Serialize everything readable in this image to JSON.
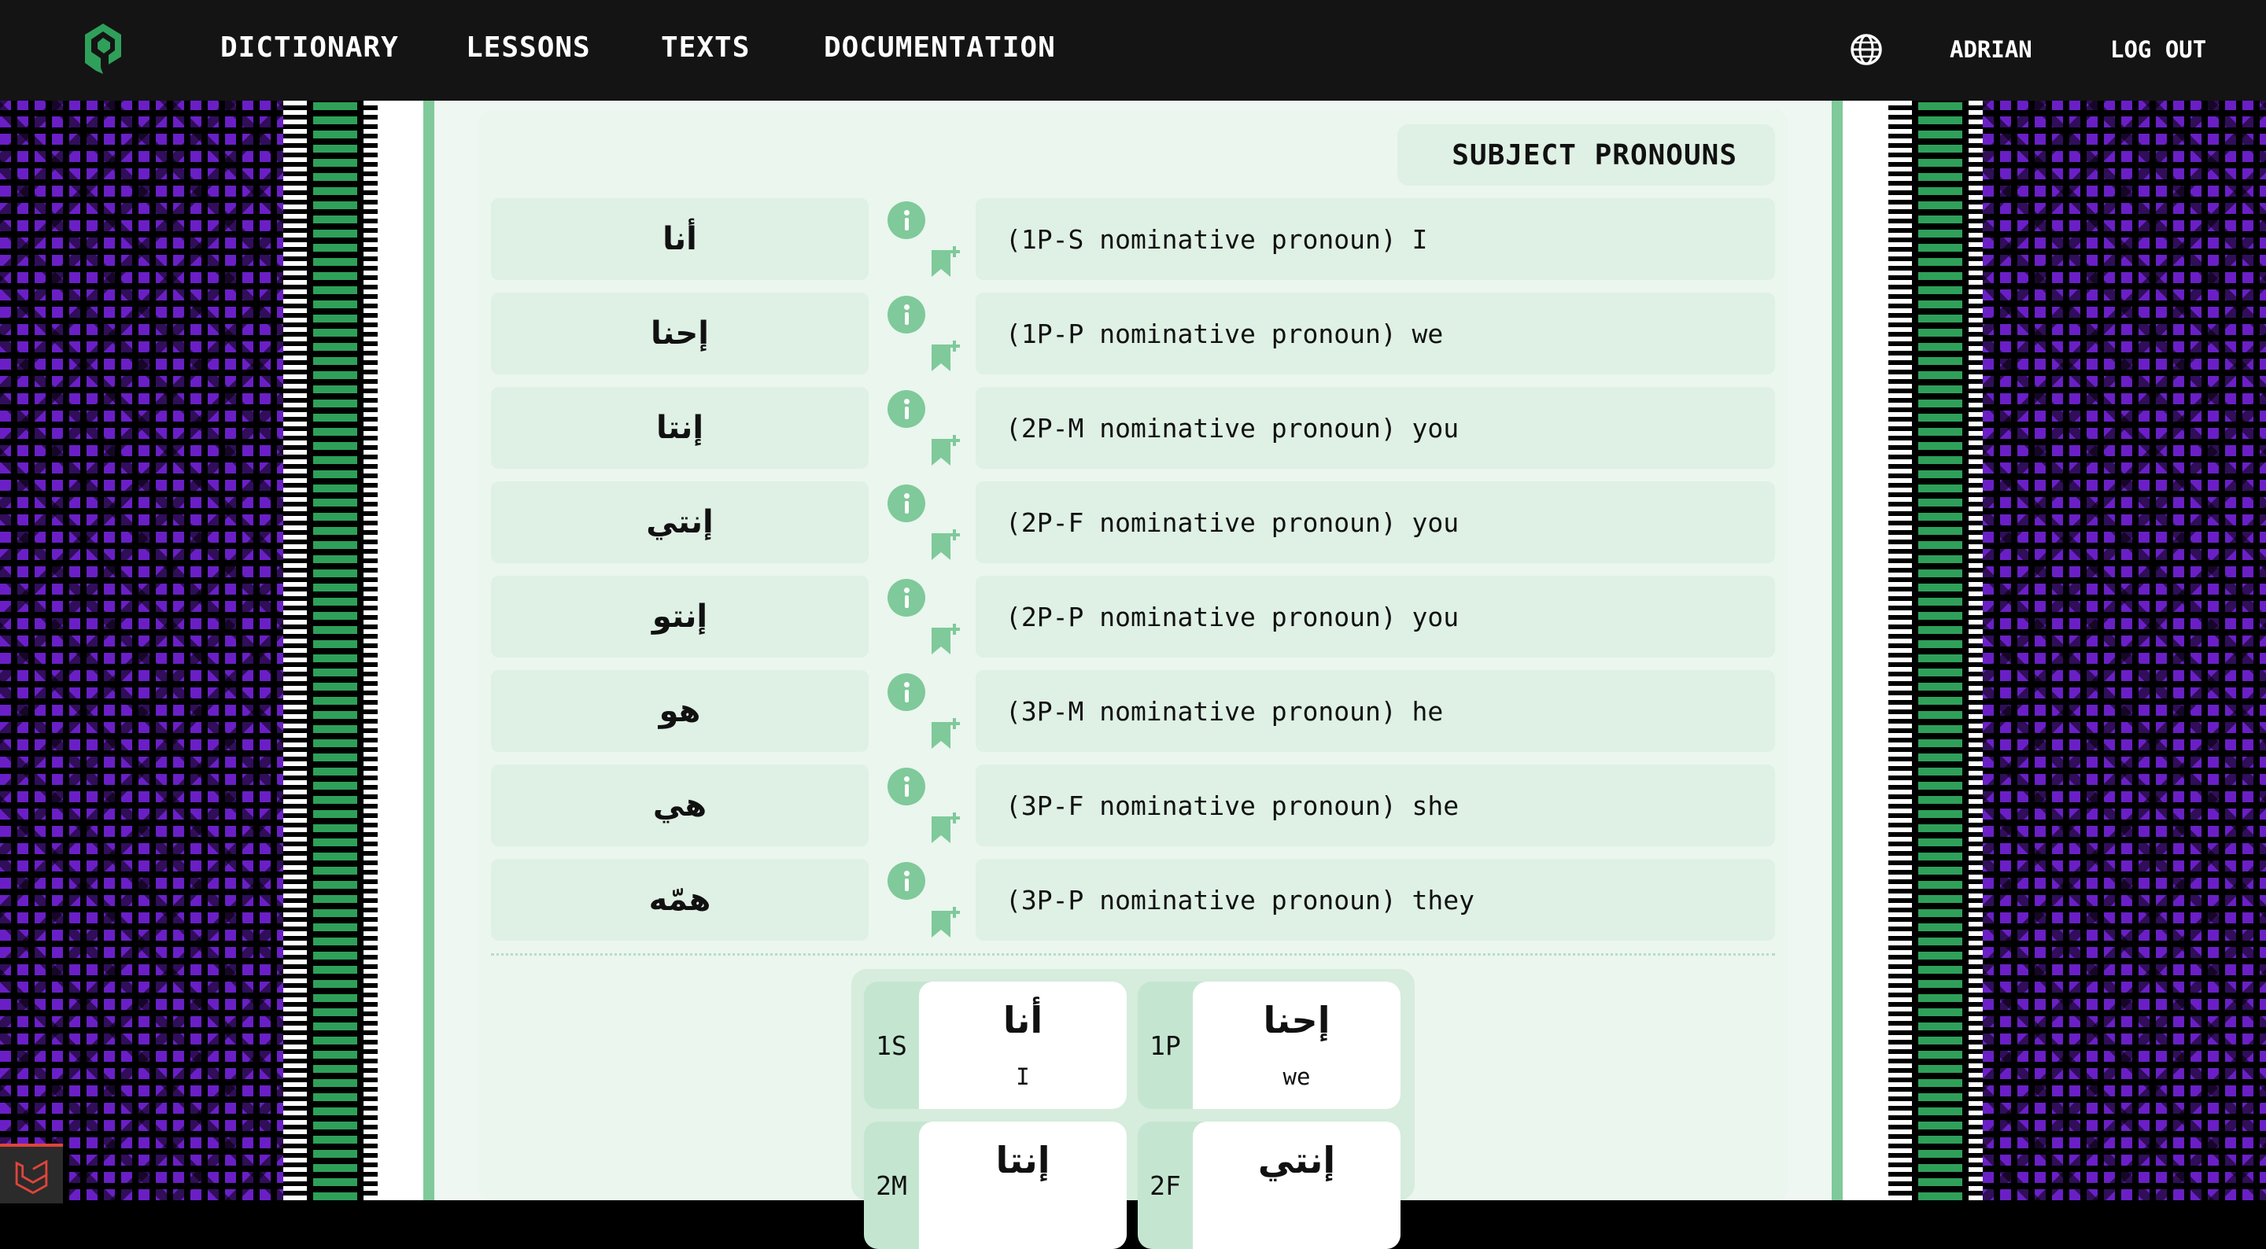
{
  "nav": {
    "logo_alt": "",
    "links": [
      "DICTIONARY",
      "LESSONS",
      "TEXTS",
      "DOCUMENTATION"
    ],
    "user": "ADRIAN",
    "logout": "LOG OUT",
    "language_icon": "globe-icon"
  },
  "section": {
    "title": "SUBJECT PRONOUNS"
  },
  "rows": [
    {
      "arabic": "أنا",
      "definition": "(1P-S nominative pronoun) I"
    },
    {
      "arabic": "إحنا",
      "definition": "(1P-P nominative pronoun) we"
    },
    {
      "arabic": "إنتا",
      "definition": "(2P-M nominative pronoun) you"
    },
    {
      "arabic": "إنتي",
      "definition": "(2P-F nominative pronoun) you"
    },
    {
      "arabic": "إنتو",
      "definition": "(2P-P nominative pronoun) you"
    },
    {
      "arabic": "هو",
      "definition": "(3P-M nominative pronoun) he"
    },
    {
      "arabic": "هي",
      "definition": "(3P-F nominative pronoun) she"
    },
    {
      "arabic": "همّه",
      "definition": "(3P-P nominative pronoun) they"
    }
  ],
  "grid": [
    {
      "code": "1S",
      "arabic": "أنا",
      "english": "I"
    },
    {
      "code": "1P",
      "arabic": "إحنا",
      "english": "we"
    },
    {
      "code": "2M",
      "arabic": "إنتا",
      "english": ""
    },
    {
      "code": "2F",
      "arabic": "إنتي",
      "english": ""
    }
  ],
  "colors": {
    "accent_green": "#7fc99a",
    "panel_green": "#dff0e5",
    "header_bg": "#141414",
    "pattern_purple": "#6a1fc6"
  }
}
